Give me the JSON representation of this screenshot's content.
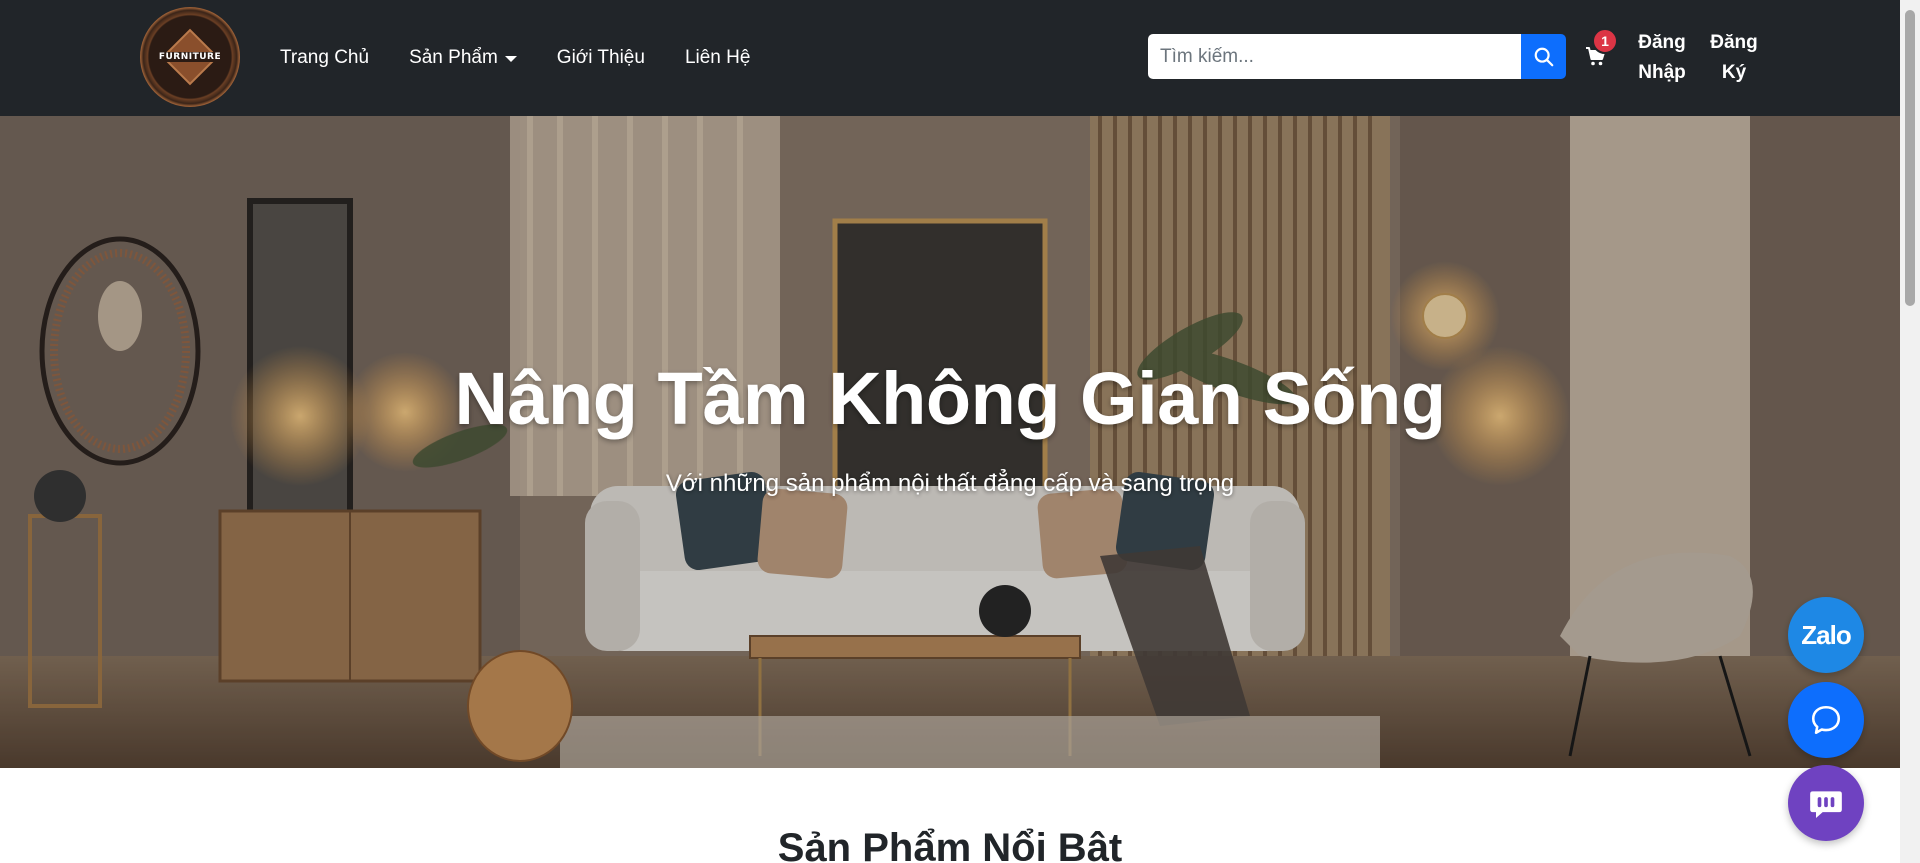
{
  "navbar": {
    "logo_text": "FURNITURE",
    "links": [
      "Trang Chủ",
      "Sản Phẩm",
      "Giới Thiệu",
      "Liên Hệ"
    ],
    "search": {
      "placeholder": "Tìm kiếm..."
    },
    "cart_count": "1",
    "login": "Đăng Nhập",
    "register": "Đăng Ký"
  },
  "hero": {
    "title": "Nâng Tầm Không Gian Sống",
    "subtitle": "Với những sản phẩm nội thất đẳng cấp và sang trọng"
  },
  "featured": {
    "title": "Sản Phẩm Nổi Bật"
  },
  "floating": {
    "zalo_label": "Zalo"
  },
  "colors": {
    "navbar_bg": "#212529",
    "primary": "#0d6efd",
    "badge": "#dc3545",
    "zalo": "#1e88e5",
    "bot": "#6f42c1"
  },
  "icons": [
    "search-icon",
    "cart-icon",
    "chat-bubble-icon",
    "chatbot-icon"
  ]
}
